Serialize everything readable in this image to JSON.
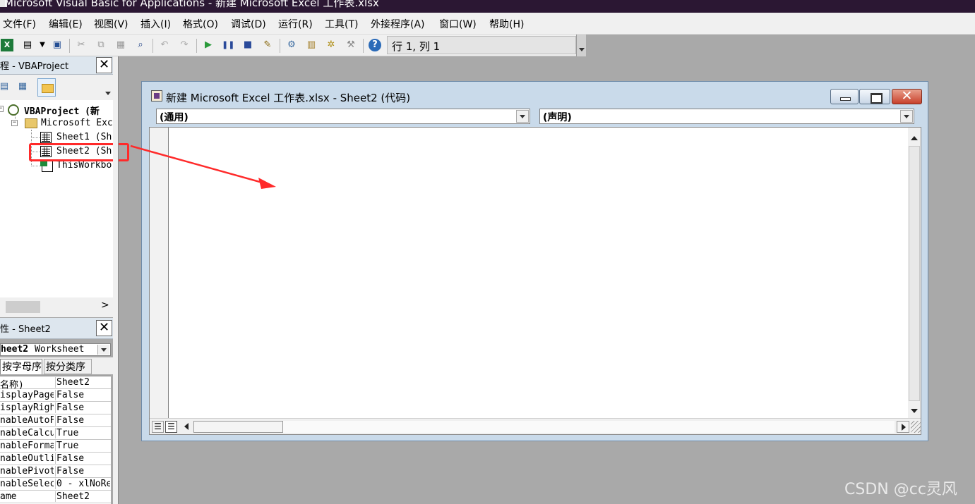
{
  "app": {
    "title": "Microsoft Visual Basic for Applications - 新建 Microsoft Excel 工作表.xlsx"
  },
  "menu": {
    "items": [
      "文件(F)",
      "编辑(E)",
      "视图(V)",
      "插入(I)",
      "格式(O)",
      "调试(D)",
      "运行(R)",
      "工具(T)",
      "外接程序(A)",
      "窗口(W)",
      "帮助(H)"
    ]
  },
  "toolbar": {
    "icons": [
      "excel-view-icon",
      "insert-userform-icon",
      "save-icon",
      "cut-icon",
      "copy-icon",
      "paste-icon",
      "find-icon",
      "undo-icon",
      "redo-icon",
      "run-icon",
      "break-icon",
      "reset-icon",
      "design-mode-icon",
      "project-explorer-icon",
      "properties-window-icon",
      "object-browser-icon",
      "toolbox-icon",
      "help-icon"
    ],
    "position_text": "行 1, 列 1"
  },
  "project": {
    "title": "程 - VBAProject",
    "close_label": "✕",
    "tree": {
      "root": "VBAProject (新",
      "folder": "Microsoft Exc",
      "items": [
        "Sheet1 (Sh",
        "Sheet2 (Sh",
        "ThisWorkbo"
      ]
    },
    "scroll_right": ">"
  },
  "properties": {
    "title": "性 - Sheet2",
    "close_label": "✕",
    "object_name": "heet2",
    "object_type": "Worksheet",
    "tabs": [
      "按字母序",
      "按分类序"
    ],
    "rows": [
      {
        "key": "名称)",
        "value": "Sheet2"
      },
      {
        "key": "isplayPage",
        "value": "False"
      },
      {
        "key": "isplayRigh",
        "value": "False"
      },
      {
        "key": "nableAutoF",
        "value": "False"
      },
      {
        "key": "nableCalcu",
        "value": "True"
      },
      {
        "key": "nableForma",
        "value": "True"
      },
      {
        "key": "nableOutli",
        "value": "False"
      },
      {
        "key": "nablePivot",
        "value": "False"
      },
      {
        "key": "nableSelec",
        "value": "0 - xlNoRe"
      },
      {
        "key": "ame",
        "value": "Sheet2"
      }
    ]
  },
  "code_window": {
    "title": "新建 Microsoft Excel 工作表.xlsx - Sheet2 (代码)",
    "object_combo": "(通用)",
    "procedure_combo": "(声明)",
    "close_label": "✕"
  },
  "annotation": {
    "highlight_color": "#ff2a2a"
  },
  "watermark": "CSDN @cc灵风"
}
